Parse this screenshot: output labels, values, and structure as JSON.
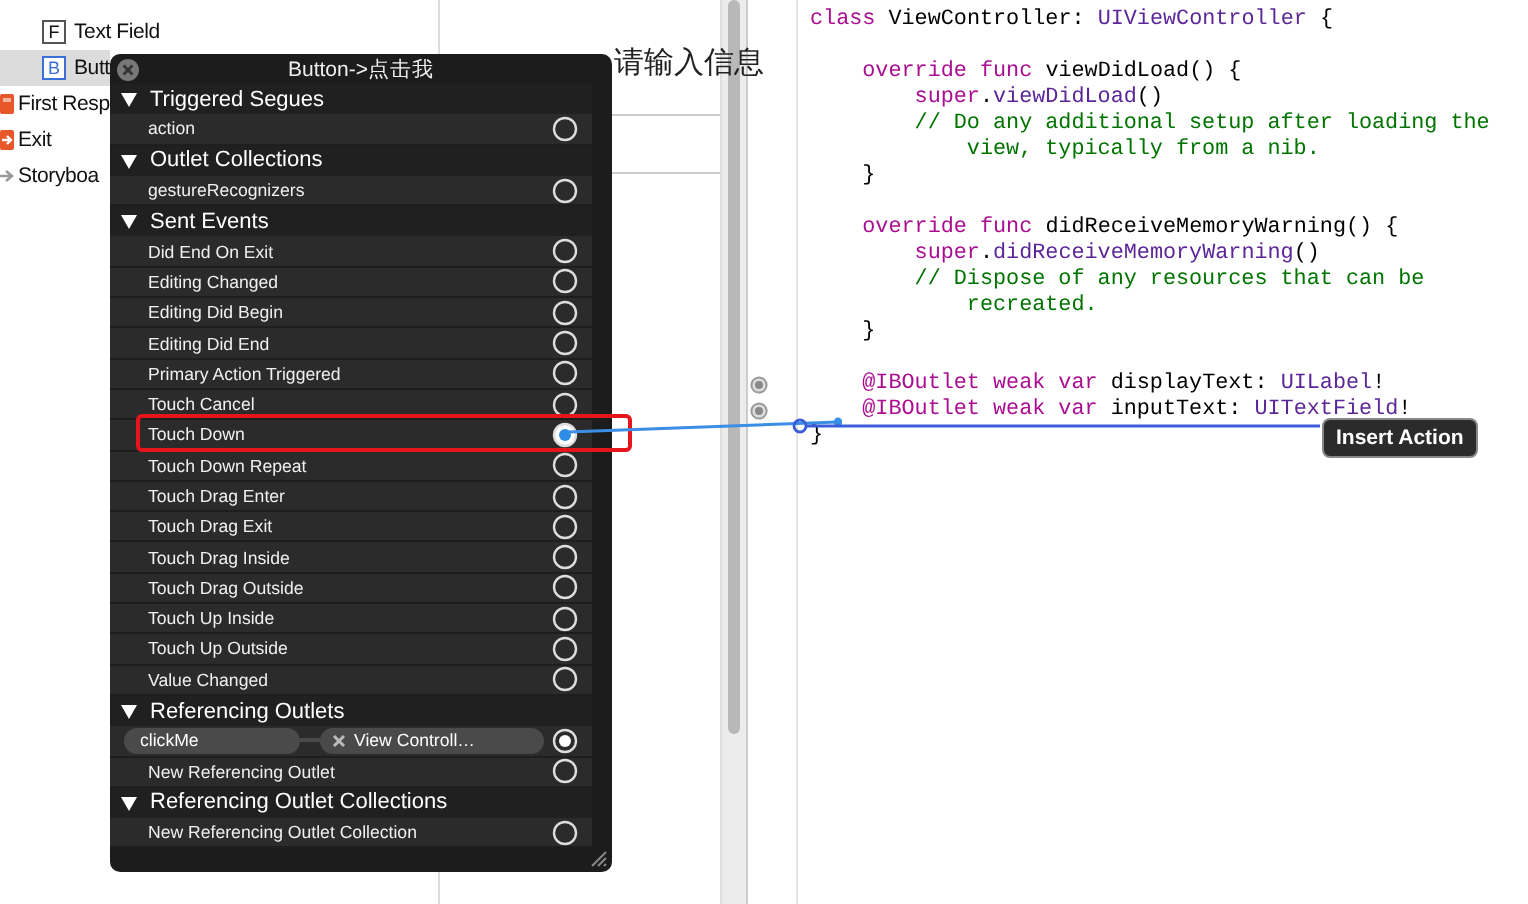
{
  "outline": {
    "items": [
      {
        "label": "Text Field",
        "icon": "F",
        "selected": false,
        "kind": "letter"
      },
      {
        "label": "Butt",
        "icon": "B",
        "selected": true,
        "kind": "letter"
      },
      {
        "label": "First Resp",
        "selected": false,
        "kind": "responder"
      },
      {
        "label": "Exit",
        "selected": false,
        "kind": "exit"
      },
      {
        "label": "Storyboa",
        "selected": false,
        "kind": "storyboard"
      }
    ]
  },
  "canvas": {
    "label": "请输入信息"
  },
  "connections_panel": {
    "title": "Button->点击我",
    "sections": [
      {
        "title": "Triggered Segues",
        "expanded": true,
        "items": [
          {
            "label": "action",
            "connected": false,
            "highlighted": false
          }
        ]
      },
      {
        "title": "Outlet Collections",
        "expanded": true,
        "items": [
          {
            "label": "gestureRecognizers",
            "connected": false,
            "highlighted": false
          }
        ]
      },
      {
        "title": "Sent Events",
        "expanded": true,
        "items": [
          {
            "label": "Did End On Exit",
            "connected": false,
            "highlighted": false
          },
          {
            "label": "Editing Changed",
            "connected": false,
            "highlighted": false
          },
          {
            "label": "Editing Did Begin",
            "connected": false,
            "highlighted": false
          },
          {
            "label": "Editing Did End",
            "connected": false,
            "highlighted": false
          },
          {
            "label": "Primary Action Triggered",
            "connected": false,
            "highlighted": false
          },
          {
            "label": "Touch Cancel",
            "connected": false,
            "highlighted": false
          },
          {
            "label": "Touch Down",
            "connected": false,
            "highlighted": true
          },
          {
            "label": "Touch Down Repeat",
            "connected": false,
            "highlighted": false
          },
          {
            "label": "Touch Drag Enter",
            "connected": false,
            "highlighted": false
          },
          {
            "label": "Touch Drag Exit",
            "connected": false,
            "highlighted": false
          },
          {
            "label": "Touch Drag Inside",
            "connected": false,
            "highlighted": false
          },
          {
            "label": "Touch Drag Outside",
            "connected": false,
            "highlighted": false
          },
          {
            "label": "Touch Up Inside",
            "connected": false,
            "highlighted": false
          },
          {
            "label": "Touch Up Outside",
            "connected": false,
            "highlighted": false
          },
          {
            "label": "Value Changed",
            "connected": false,
            "highlighted": false
          }
        ]
      },
      {
        "title": "Referencing Outlets",
        "expanded": true,
        "items": [
          {
            "label": "clickMe",
            "target": "View Controll…",
            "connected": true,
            "highlighted": false
          },
          {
            "label": "New Referencing Outlet",
            "connected": false,
            "highlighted": false
          }
        ]
      },
      {
        "title": "Referencing Outlet Collections",
        "expanded": true,
        "items": [
          {
            "label": "New Referencing Outlet Collection",
            "connected": false,
            "highlighted": false
          }
        ]
      }
    ]
  },
  "editor": {
    "lines": [
      {
        "kind": "code",
        "connected": false,
        "tokens": [
          {
            "kind": "kw",
            "text": "class"
          },
          {
            "kind": "plain",
            "text": "ViewController:"
          },
          {
            "kind": "type",
            "text": "UIViewController"
          },
          {
            "kind": "plain",
            "text": "{"
          }
        ],
        "children": [
          {
            "kind": "blank"
          },
          {
            "kind": "code",
            "connected": false,
            "tokens": [
              {
                "kind": "kw",
                "text": "override"
              },
              {
                "kind": "kw",
                "text": "func"
              },
              {
                "kind": "plain",
                "text": "viewDidLoad() {"
              }
            ],
            "children": [
              {
                "kind": "code",
                "connected": false,
                "tokens": [
                  {
                    "kind": "kw",
                    "text": "super"
                  },
                  {
                    "kind": "plain",
                    "text": "."
                  },
                  {
                    "kind": "type",
                    "text": "viewDidLoad"
                  },
                  {
                    "kind": "plain",
                    "text": "()"
                  }
                ]
              },
              {
                "kind": "code",
                "connected": false,
                "tokens": [
                  {
                    "kind": "comment",
                    "text": "// Do any additional setup after loading the view, typically from a nib."
                  }
                ]
              }
            ]
          },
          {
            "kind": "code",
            "connected": false,
            "tokens": [
              {
                "kind": "plain",
                "text": "}"
              }
            ]
          },
          {
            "kind": "blank"
          },
          {
            "kind": "code",
            "connected": false,
            "tokens": [
              {
                "kind": "kw",
                "text": "override"
              },
              {
                "kind": "kw",
                "text": "func"
              },
              {
                "kind": "plain",
                "text": "didReceiveMemoryWarning() {"
              }
            ],
            "children": [
              {
                "kind": "code",
                "connected": false,
                "tokens": [
                  {
                    "kind": "kw",
                    "text": "super"
                  },
                  {
                    "kind": "plain",
                    "text": "."
                  },
                  {
                    "kind": "type",
                    "text": "didReceiveMemoryWarning"
                  },
                  {
                    "kind": "plain",
                    "text": "()"
                  }
                ]
              },
              {
                "kind": "code",
                "connected": false,
                "tokens": [
                  {
                    "kind": "comment",
                    "text": "// Dispose of any resources that can be recreated."
                  }
                ]
              }
            ]
          },
          {
            "kind": "code",
            "connected": false,
            "tokens": [
              {
                "kind": "plain",
                "text": "}"
              }
            ]
          },
          {
            "kind": "blank"
          },
          {
            "kind": "code",
            "connected": true,
            "tokens": [
              {
                "kind": "kw",
                "text": "@IBOutlet weak var"
              },
              {
                "kind": "plain",
                "text": "displayText:"
              },
              {
                "kind": "type",
                "text": "UILabel"
              },
              {
                "kind": "plain",
                "text": "!"
              }
            ]
          },
          {
            "kind": "code",
            "connected": true,
            "tokens": [
              {
                "kind": "kw",
                "text": "@IBOutlet weak var"
              },
              {
                "kind": "plain",
                "text": "inputText:"
              },
              {
                "kind": "type",
                "text": "UITextField"
              },
              {
                "kind": "plain",
                "text": "!"
              }
            ]
          }
        ]
      },
      {
        "kind": "code",
        "connected": false,
        "tokens": [
          {
            "kind": "plain",
            "text": "}"
          }
        ]
      }
    ]
  },
  "tooltip": {
    "text": "Insert Action"
  }
}
